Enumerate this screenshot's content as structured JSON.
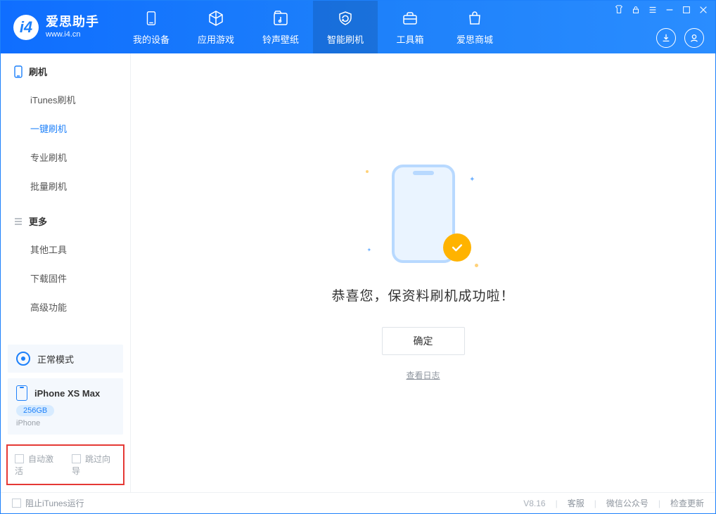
{
  "app": {
    "name": "爱思助手",
    "url": "www.i4.cn"
  },
  "nav": [
    {
      "label": "我的设备",
      "icon": "device"
    },
    {
      "label": "应用游戏",
      "icon": "cube"
    },
    {
      "label": "铃声壁纸",
      "icon": "music-folder"
    },
    {
      "label": "智能刷机",
      "icon": "refresh-shield",
      "active": true
    },
    {
      "label": "工具箱",
      "icon": "toolbox"
    },
    {
      "label": "爱思商城",
      "icon": "shop"
    }
  ],
  "sidebar": {
    "section1": {
      "title": "刷机",
      "items": [
        "iTunes刷机",
        "一键刷机",
        "专业刷机",
        "批量刷机"
      ],
      "active_index": 1
    },
    "section2": {
      "title": "更多",
      "items": [
        "其他工具",
        "下载固件",
        "高级功能"
      ]
    },
    "mode_panel": {
      "label": "正常模式"
    },
    "device_panel": {
      "name": "iPhone XS Max",
      "capacity": "256GB",
      "subtype": "iPhone"
    },
    "highlight": {
      "opt1": "自动激活",
      "opt2": "跳过向导"
    }
  },
  "main": {
    "success_text": "恭喜您，保资料刷机成功啦！",
    "ok_button": "确定",
    "view_log": "查看日志"
  },
  "footer": {
    "block_itunes": "阻止iTunes运行",
    "version": "V8.16",
    "links": [
      "客服",
      "微信公众号",
      "检查更新"
    ]
  }
}
